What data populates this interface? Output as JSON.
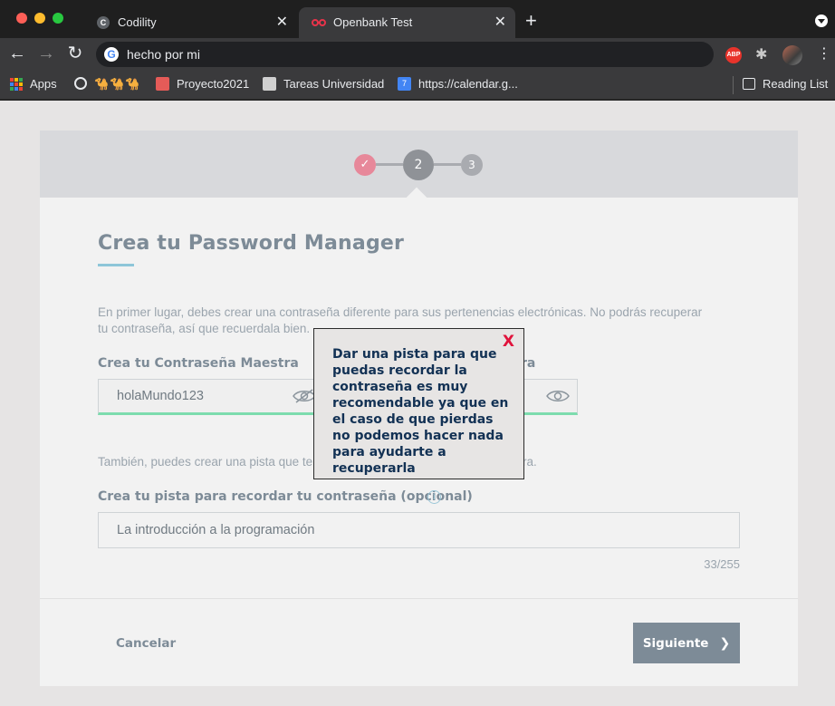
{
  "browser": {
    "tabs": [
      {
        "label": "Codility",
        "favicon": "codility-icon"
      },
      {
        "label": "Openbank Test",
        "favicon": "openbank-icon",
        "active": true
      }
    ],
    "url": "hecho por mi",
    "bookmarks": [
      {
        "label": "Apps",
        "icon": "apps-grid-icon"
      },
      {
        "label": "",
        "icon": "globe-icon"
      },
      {
        "label": "🐪🐪🐪",
        "icon": "camel-icon"
      },
      {
        "label": "Proyecto2021",
        "icon": "trello-icon"
      },
      {
        "label": "Tareas Universidad",
        "icon": "page-icon"
      },
      {
        "label": "https://calendar.g...",
        "icon": "calendar-icon"
      }
    ],
    "reading_list": "Reading List",
    "extensions": {
      "adblock": "ABP"
    }
  },
  "stepper": {
    "step1": "✓",
    "step2": "2",
    "step3": "3"
  },
  "form": {
    "title": "Crea tu Password Manager",
    "intro": "En primer lugar, debes crear una contraseña diferente para sus pertenencias electrónicas. No podrás recuperar tu contraseña, así que recuerdala bien.",
    "master_label": "Crea tu Contraseña Maestra",
    "master_value": "holaMundo123",
    "repeat_label_tail": "ra",
    "also_text": "También, puedes crear una pista que te ayude a recordar tu contraseña maestra.",
    "hint_label": "Crea tu pista para recordar tu contraseña (opcional)",
    "hint_value": "La introducción a la programación",
    "counter": "33/255",
    "cancel": "Cancelar",
    "next": "Siguiente",
    "next_chevron": "❯"
  },
  "popup": {
    "close": "X",
    "message": "Dar una pista para que puedas recordar la contraseña es muy recomendable ya que en el caso de que pierdas no podemos hacer nada para ayudarte a recuperarla"
  },
  "colors": {
    "accent_pink": "#e7889a",
    "primary_button": "#7d8b97",
    "field_underline": "#7ddcae",
    "close_red": "#e0143c"
  }
}
